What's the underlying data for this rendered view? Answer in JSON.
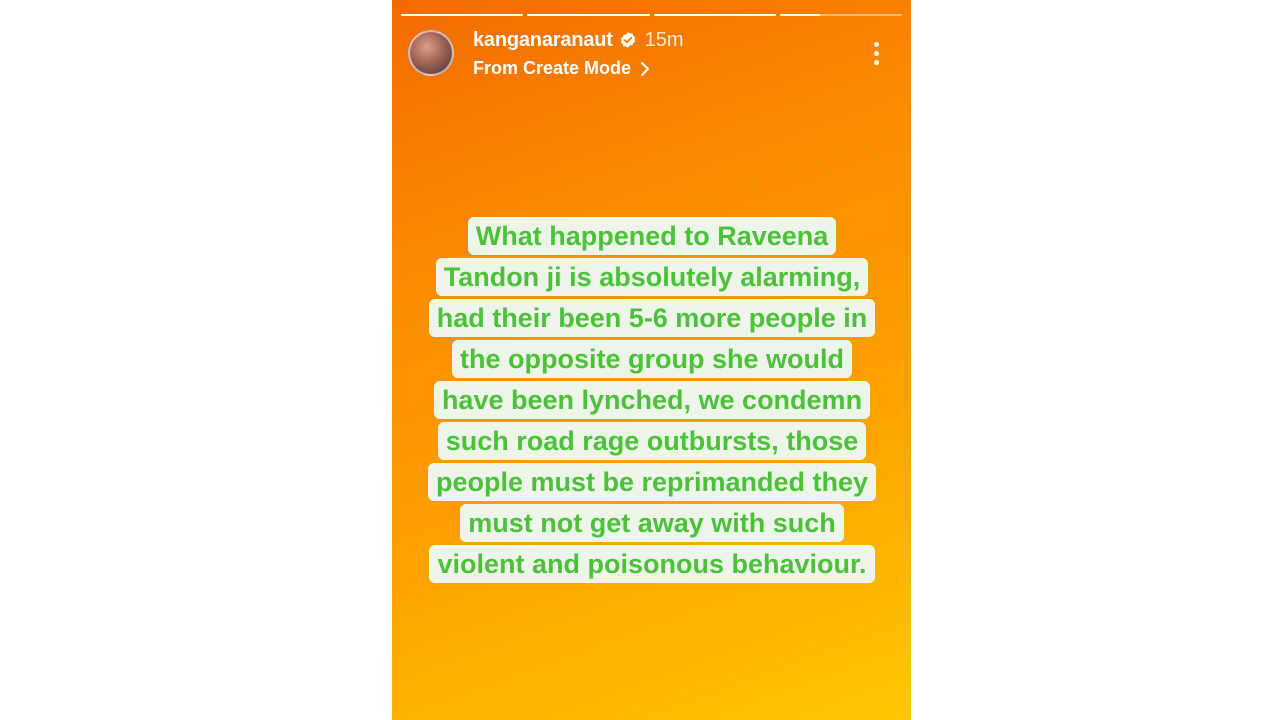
{
  "story": {
    "progress_segments": [
      1,
      1,
      1,
      0.33
    ],
    "gradient_colors": [
      "#f26a00",
      "#fb8a00",
      "#fda300",
      "#ffc800"
    ]
  },
  "header": {
    "username": "kanganaranaut",
    "verified": true,
    "time": "15m",
    "subtitle": "From Create Mode"
  },
  "icons": {
    "verified": "verified-badge-icon",
    "chevron": "chevron-right-icon",
    "more": "more-vertical-icon"
  },
  "message": {
    "text": "What happened to Raveena Tandon ji is absolutely alarming, had their been 5-6 more people in the opposite group she would have been lynched, we condemn such road rage outbursts, those people must be reprimanded they must not get away with such violent and poisonous behaviour.",
    "text_color": "#4cc23a",
    "highlight_color": "#eef6ea"
  }
}
